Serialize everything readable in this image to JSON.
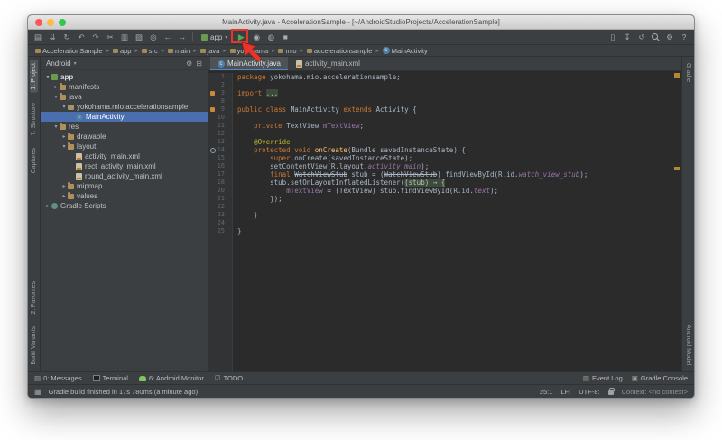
{
  "window": {
    "title": "MainActivity.java - AccelerationSample - [~/AndroidStudioProjects/AccelerationSample]"
  },
  "colors": {
    "annotation_red": "#e8352b",
    "run_green": "#53a956",
    "selection_blue": "#4b6eaf",
    "editor_bg": "#2b2b2b",
    "panel_bg": "#3c3f41",
    "android_green": "#7ec45c"
  },
  "toolbar": {
    "left_icons": [
      {
        "name": "open-icon",
        "glyph": "▤"
      },
      {
        "name": "save-all-icon",
        "glyph": "⇊"
      },
      {
        "name": "sync-icon",
        "glyph": "↻"
      },
      {
        "name": "undo-icon",
        "glyph": "↶"
      },
      {
        "name": "redo-icon",
        "glyph": "↷"
      },
      {
        "name": "cut-icon",
        "glyph": "✂"
      },
      {
        "name": "copy-icon",
        "glyph": "▥"
      },
      {
        "name": "paste-icon",
        "glyph": "▨"
      },
      {
        "name": "find-icon",
        "glyph": "◎"
      },
      {
        "name": "back-icon",
        "glyph": "←"
      },
      {
        "name": "forward-icon",
        "glyph": "→"
      }
    ],
    "run_config_label": "app",
    "run_glyph": "▶",
    "mid_icons": [
      {
        "name": "debug-icon",
        "glyph": "◉"
      },
      {
        "name": "coverage-icon",
        "glyph": "◍"
      },
      {
        "name": "stop-icon",
        "glyph": "■"
      }
    ],
    "right_icons": [
      {
        "name": "avd-manager-icon",
        "glyph": "▯"
      },
      {
        "name": "sdk-manager-icon",
        "glyph": "↧"
      },
      {
        "name": "gradle-sync-icon",
        "glyph": "↺"
      },
      {
        "name": "search-icon",
        "css": "css-search"
      },
      {
        "name": "settings-icon",
        "glyph": "⚙"
      },
      {
        "name": "help-icon",
        "glyph": "?"
      }
    ]
  },
  "navbar": {
    "items": [
      "AccelerationSample",
      "app",
      "src",
      "main",
      "java",
      "yokohama",
      "mio",
      "accelerationsample",
      "MainActivity"
    ]
  },
  "left_stripe": {
    "top": [
      {
        "label": "1: Project",
        "active": true
      },
      {
        "label": "7: Structure",
        "active": false
      },
      {
        "label": "Captures",
        "active": false
      }
    ],
    "bottom": [
      {
        "label": "2: Favorites",
        "active": false
      },
      {
        "label": "Build Variants",
        "active": false
      }
    ]
  },
  "right_stripe": {
    "top": [
      {
        "label": "Gradle",
        "active": false
      }
    ],
    "bottom": [
      {
        "label": "Android Model",
        "active": false
      }
    ]
  },
  "project_panel": {
    "header": "Android",
    "tree": [
      {
        "label": "app",
        "indent": 0,
        "arrow": "down",
        "icon": "module",
        "bold": true
      },
      {
        "label": "manifests",
        "indent": 1,
        "arrow": "right",
        "icon": "folder"
      },
      {
        "label": "java",
        "indent": 1,
        "arrow": "down",
        "icon": "folder"
      },
      {
        "label": "yokohama.mio.accelerationsample",
        "indent": 2,
        "arrow": "down",
        "icon": "package"
      },
      {
        "label": "MainActivity",
        "indent": 3,
        "arrow": "none",
        "icon": "class",
        "selected": true
      },
      {
        "label": "res",
        "indent": 1,
        "arrow": "down",
        "icon": "folder"
      },
      {
        "label": "drawable",
        "indent": 2,
        "arrow": "right",
        "icon": "folder"
      },
      {
        "label": "layout",
        "indent": 2,
        "arrow": "down",
        "icon": "folder"
      },
      {
        "label": "activity_main.xml",
        "indent": 3,
        "arrow": "none",
        "icon": "xml"
      },
      {
        "label": "rect_activity_main.xml",
        "indent": 3,
        "arrow": "none",
        "icon": "xml"
      },
      {
        "label": "round_activity_main.xml",
        "indent": 3,
        "arrow": "none",
        "icon": "xml"
      },
      {
        "label": "mipmap",
        "indent": 2,
        "arrow": "right",
        "icon": "folder"
      },
      {
        "label": "values",
        "indent": 2,
        "arrow": "right",
        "icon": "folder"
      },
      {
        "label": "Gradle Scripts",
        "indent": 0,
        "arrow": "right",
        "icon": "gradle"
      }
    ]
  },
  "editor": {
    "tabs": [
      {
        "label": "MainActivity.java",
        "icon": "class",
        "active": true
      },
      {
        "label": "activity_main.xml",
        "icon": "xml",
        "active": false
      }
    ],
    "code": [
      {
        "n": "1",
        "s": [
          [
            "kw",
            "package "
          ],
          [
            "pl",
            "yokohama.mio.accelerationsample;"
          ]
        ]
      },
      {
        "n": "2",
        "s": []
      },
      {
        "n": "3",
        "g": "marker",
        "s": [
          [
            "kw",
            "import "
          ],
          [
            "fold",
            "..."
          ]
        ]
      },
      {
        "n": "8",
        "s": []
      },
      {
        "n": "9",
        "g": "marker",
        "s": [
          [
            "kw",
            "public class "
          ],
          [
            "pl",
            "MainActivity "
          ],
          [
            "kw",
            "extends "
          ],
          [
            "pl",
            "Activity {"
          ]
        ]
      },
      {
        "n": "10",
        "s": []
      },
      {
        "n": "11",
        "s": [
          [
            "pl",
            "    "
          ],
          [
            "kw",
            "private "
          ],
          [
            "pl",
            "TextView "
          ],
          [
            "fld",
            "mTextView"
          ],
          [
            "pl",
            ";"
          ]
        ]
      },
      {
        "n": "12",
        "s": []
      },
      {
        "n": "13",
        "s": [
          [
            "pl",
            "    "
          ],
          [
            "ann",
            "@Override"
          ]
        ]
      },
      {
        "n": "14",
        "g": "override",
        "s": [
          [
            "pl",
            "    "
          ],
          [
            "kw",
            "protected void "
          ],
          [
            "mth",
            "onCreate"
          ],
          [
            "pl",
            "(Bundle savedInstanceState) {"
          ]
        ]
      },
      {
        "n": "15",
        "s": [
          [
            "pl",
            "        "
          ],
          [
            "kw",
            "super"
          ],
          [
            "pl",
            ".onCreate(savedInstanceState);"
          ]
        ]
      },
      {
        "n": "16",
        "s": [
          [
            "pl",
            "        setContentView(R.layout."
          ],
          [
            "res",
            "activity_main"
          ],
          [
            "pl",
            ");"
          ]
        ]
      },
      {
        "n": "17",
        "s": [
          [
            "pl",
            "        "
          ],
          [
            "kw",
            "final "
          ],
          [
            "dep",
            "WatchViewStub"
          ],
          [
            "pl",
            " stub = ("
          ],
          [
            "dep",
            "WatchViewStub"
          ],
          [
            "pl",
            ") findViewById(R.id."
          ],
          [
            "res",
            "watch_view_stub"
          ],
          [
            "pl",
            ");"
          ]
        ]
      },
      {
        "n": "18",
        "s": [
          [
            "pl",
            "        stub.setOnLayoutInflatedListener("
          ],
          [
            "fold",
            "(stub) → {"
          ]
        ]
      },
      {
        "n": "20",
        "s": [
          [
            "pl",
            "            "
          ],
          [
            "fld",
            "mTextView"
          ],
          [
            "pl",
            " = (TextView) stub.findViewById(R.id."
          ],
          [
            "res",
            "text"
          ],
          [
            "pl",
            ");"
          ]
        ]
      },
      {
        "n": "21",
        "s": [
          [
            "pl",
            "        });"
          ]
        ]
      },
      {
        "n": "22",
        "s": []
      },
      {
        "n": "23",
        "s": [
          [
            "pl",
            "    }"
          ]
        ]
      },
      {
        "n": "24",
        "s": []
      },
      {
        "n": "25",
        "s": [
          [
            "pl",
            "}"
          ]
        ]
      }
    ]
  },
  "bottombar": {
    "left": [
      {
        "label": "0: Messages",
        "icon": "messages-icon",
        "glyph": "▤"
      },
      {
        "label": "Terminal",
        "icon": "terminal-icon",
        "shape": "ic-term"
      },
      {
        "label": "6: Android Monitor",
        "icon": "android-icon",
        "shape": "ic-android"
      },
      {
        "label": "TODO",
        "icon": "todo-icon",
        "glyph": "☑"
      }
    ],
    "right": [
      {
        "label": "Event Log",
        "icon": "event-log-icon",
        "glyph": "▤"
      },
      {
        "label": "Gradle Console",
        "icon": "gradle-console-icon",
        "glyph": "▣"
      }
    ]
  },
  "statusbar": {
    "message": "Gradle build finished in 17s 780ms (a minute ago)",
    "caret": "25:1",
    "line_ending": "LF:",
    "encoding": "UTF-8:",
    "context": "Context: <no context>"
  }
}
